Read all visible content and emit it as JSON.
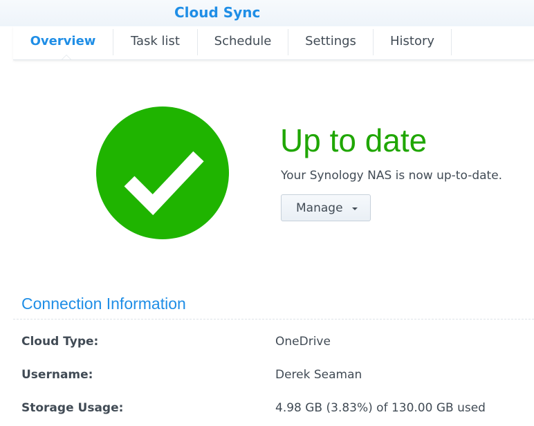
{
  "app": {
    "title": "Cloud Sync"
  },
  "tabs": [
    {
      "label": "Overview",
      "active": true
    },
    {
      "label": "Task list",
      "active": false
    },
    {
      "label": "Schedule",
      "active": false
    },
    {
      "label": "Settings",
      "active": false
    },
    {
      "label": "History",
      "active": false
    }
  ],
  "status": {
    "icon": "checkmark-icon",
    "title": "Up to date",
    "description": "Your Synology NAS is now up-to-date.",
    "manage_label": "Manage",
    "color": "#1fb400"
  },
  "connection": {
    "title": "Connection Information",
    "rows": [
      {
        "label": "Cloud Type:",
        "value": "OneDrive"
      },
      {
        "label": "Username:",
        "value": "Derek Seaman"
      },
      {
        "label": "Storage Usage:",
        "value": "4.98 GB (3.83%) of 130.00 GB used"
      }
    ]
  },
  "colors": {
    "accent": "#1f8ee6",
    "success": "#1fa600",
    "text": "#414b55"
  }
}
